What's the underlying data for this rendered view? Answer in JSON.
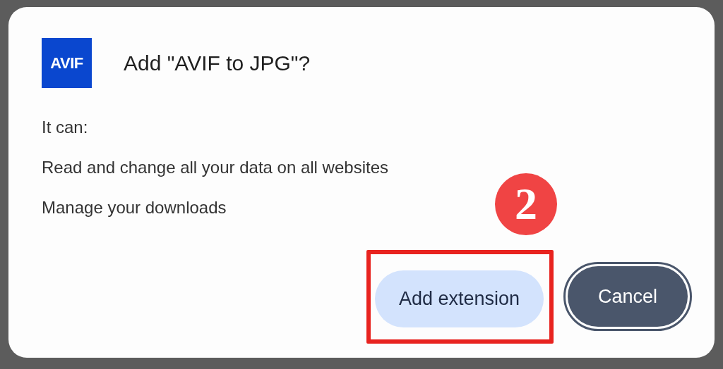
{
  "dialog": {
    "icon_label": "AVIF",
    "title": "Add \"AVIF to JPG\"?",
    "intro": "It can:",
    "permissions": [
      "Read and change all your data on all websites",
      "Manage your downloads"
    ],
    "buttons": [
      {
        "label": "Add extension",
        "kind": "primary",
        "highlighted": true
      },
      {
        "label": "Cancel",
        "kind": "focused",
        "highlighted": false
      }
    ]
  },
  "annotation": {
    "step": "2"
  }
}
